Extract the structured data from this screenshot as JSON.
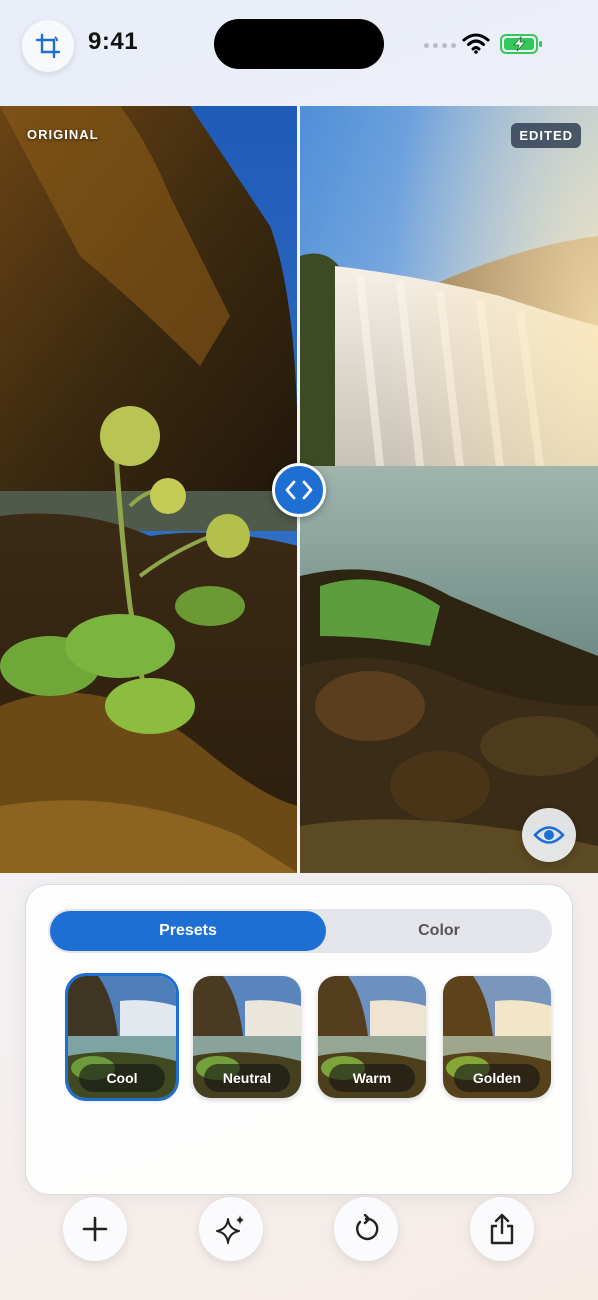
{
  "status_bar": {
    "time": "9:41",
    "icons": [
      "crop-icon",
      "signal-icon",
      "wifi-icon",
      "battery-charging-icon"
    ],
    "battery_color": "#34c759"
  },
  "photo": {
    "original_label": "ORIGINAL",
    "edited_label": "EDITED",
    "compare_handle_icon": "chevron-left-right-icon",
    "preview_icon": "eye-icon"
  },
  "panel": {
    "tabs": [
      {
        "label": "Presets",
        "active": true
      },
      {
        "label": "Color",
        "active": false
      }
    ],
    "presets": [
      {
        "label": "Cool",
        "selected": true
      },
      {
        "label": "Neutral",
        "selected": false
      },
      {
        "label": "Warm",
        "selected": false
      },
      {
        "label": "Golden",
        "selected": false
      }
    ]
  },
  "toolbar": {
    "icons": [
      "plus-icon",
      "sparkle-icon",
      "rotate-icon",
      "share-icon"
    ]
  },
  "colors": {
    "accent": "#1d6fd4",
    "inactive_tab_bg": "#e4e5ea"
  }
}
